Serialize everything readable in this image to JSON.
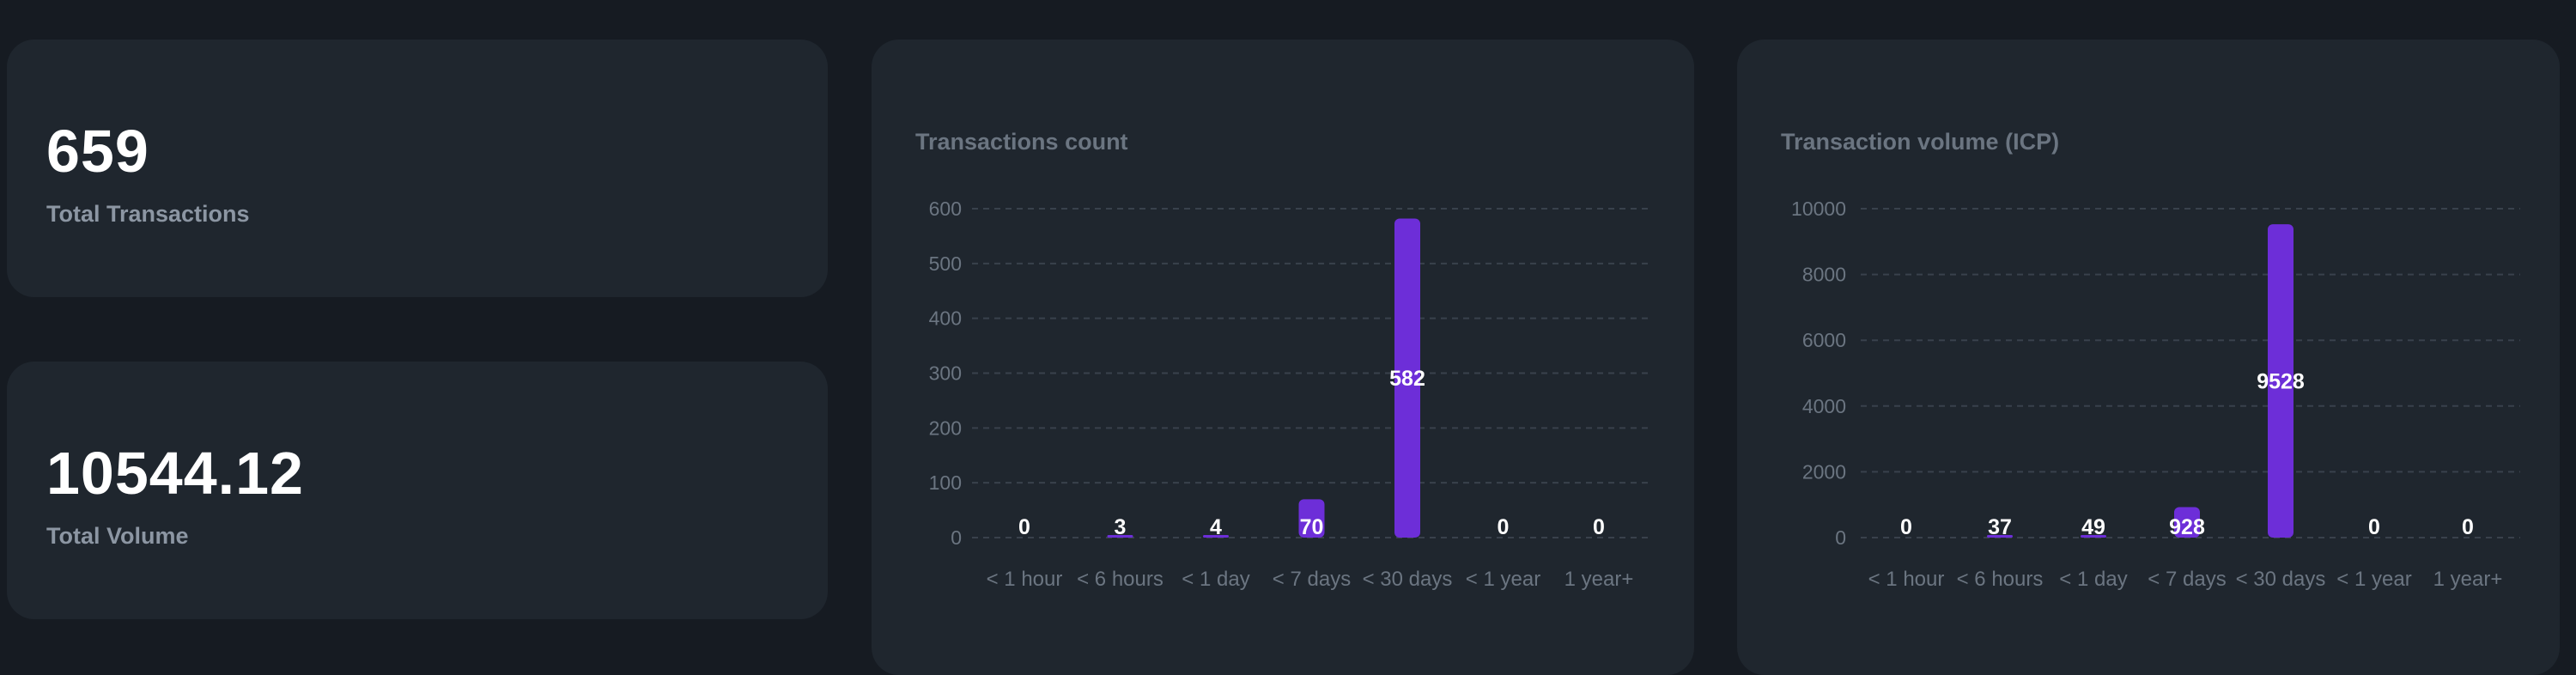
{
  "stats": [
    {
      "value": "659",
      "label": "Total Transactions"
    },
    {
      "value": "10544.12",
      "label": "Total Volume"
    }
  ],
  "colors": {
    "background": "#161b22",
    "card": "#1f262e",
    "bar": "#6d2ed8",
    "accent_text": "#ffffff"
  },
  "chart_data": [
    {
      "type": "bar",
      "title": "Transactions count",
      "categories": [
        "< 1 hour",
        "< 6 hours",
        "< 1 day",
        "< 7 days",
        "< 30 days",
        "< 1 year",
        "1 year+"
      ],
      "values": [
        0,
        3,
        4,
        70,
        582,
        0,
        0
      ],
      "data_labels": [
        "0",
        "3",
        "4",
        "70",
        "582",
        "0",
        "0"
      ],
      "yticks": [
        "0",
        "100",
        "200",
        "300",
        "400",
        "500",
        "600"
      ],
      "ylim": [
        0,
        600
      ],
      "grid": true
    },
    {
      "type": "bar",
      "title": "Transaction volume (ICP)",
      "categories": [
        "< 1 hour",
        "< 6 hours",
        "< 1 day",
        "< 7 days",
        "< 30 days",
        "< 1 year",
        "1 year+"
      ],
      "values": [
        0,
        37,
        49,
        928,
        9528,
        0,
        0
      ],
      "data_labels": [
        "0",
        "37",
        "49",
        "928",
        "9528",
        "0",
        "0"
      ],
      "yticks": [
        "0",
        "2000",
        "4000",
        "6000",
        "8000",
        "10000"
      ],
      "ylim": [
        0,
        10000
      ],
      "grid": true
    }
  ]
}
